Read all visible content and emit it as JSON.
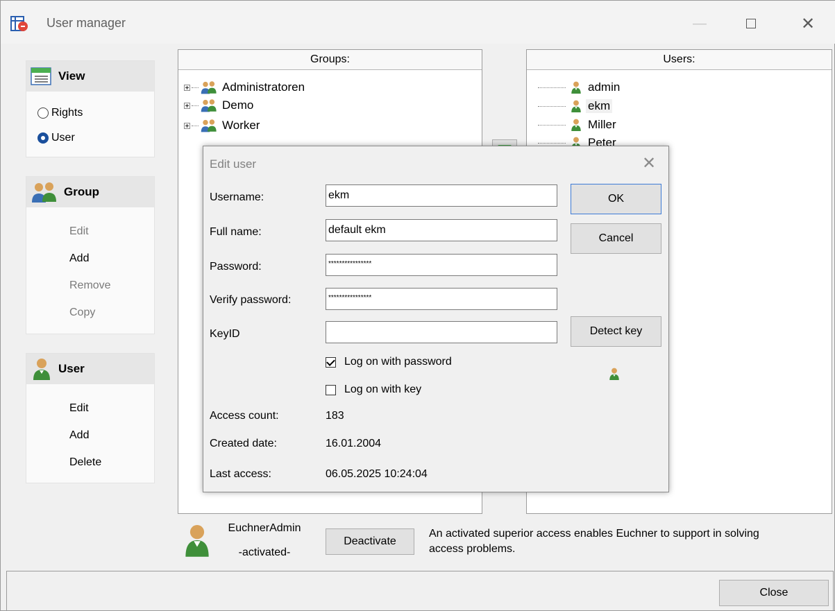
{
  "window": {
    "title": "User manager",
    "minimize": "—",
    "maximize": "☐",
    "close": "✕"
  },
  "sidebar": {
    "view": {
      "title": "View",
      "options": [
        {
          "label": "Rights",
          "selected": false
        },
        {
          "label": "User",
          "selected": true
        }
      ]
    },
    "group": {
      "title": "Group",
      "actions": [
        {
          "label": "Edit",
          "enabled": false
        },
        {
          "label": "Add",
          "enabled": true
        },
        {
          "label": "Remove",
          "enabled": false
        },
        {
          "label": "Copy",
          "enabled": false
        }
      ]
    },
    "user": {
      "title": "User",
      "actions": [
        {
          "label": "Edit",
          "enabled": true
        },
        {
          "label": "Add",
          "enabled": true
        },
        {
          "label": "Delete",
          "enabled": true
        }
      ]
    }
  },
  "groups": {
    "header": "Groups:",
    "items": [
      "Administratoren",
      "Demo",
      "Worker"
    ]
  },
  "users": {
    "header": "Users:",
    "items": [
      "admin",
      "ekm",
      "Miller",
      "Peter"
    ],
    "selected": "ekm"
  },
  "dialog": {
    "title": "Edit user",
    "close": "✕",
    "username_label": "Username:",
    "username": "ekm",
    "fullname_label": "Full name:",
    "fullname": "default ekm",
    "password_label": "Password:",
    "password": "****************",
    "verify_label": "Verify password:",
    "verify": "****************",
    "keyid_label": "KeyID",
    "keyid": "",
    "ok": "OK",
    "cancel": "Cancel",
    "detect_key": "Detect key",
    "logon_password": "Log on with password",
    "logon_password_checked": true,
    "logon_key": "Log on with key",
    "logon_key_checked": false,
    "access_count_label": "Access count:",
    "access_count": "183",
    "created_label": "Created date:",
    "created": "16.01.2004",
    "last_access_label": "Last access:",
    "last_access": "06.05.2025 10:24:04"
  },
  "superior": {
    "name": "EuchnerAdmin",
    "status": "-activated-",
    "deactivate": "Deactivate",
    "info_line1": "An activated superior access enables Euchner to support in solving",
    "info_line2": "access problems."
  },
  "footer": {
    "close": "Close"
  },
  "colors": {
    "accent": "#1a4f9c",
    "default_button_border": "#3d7bd6",
    "user_icon_green": "#3f8f3a",
    "user_icon_skin": "#d9a25a"
  }
}
